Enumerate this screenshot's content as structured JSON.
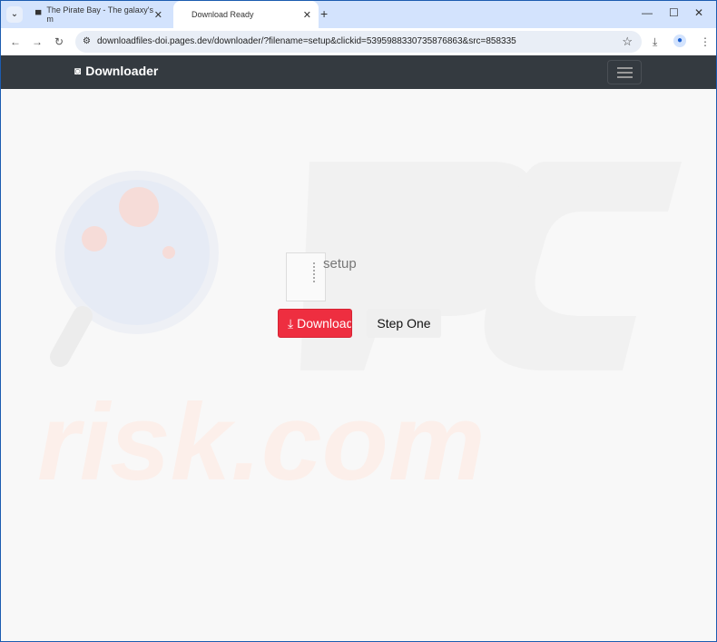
{
  "browser": {
    "tabs": [
      {
        "label": "The Pirate Bay - The galaxy's m",
        "icon": "pirate-ship-icon"
      },
      {
        "label": "Download Ready",
        "active": true
      }
    ],
    "url": "downloadfiles-doi.pages.dev/downloader/?filename=setup&clickid=5395988330735876863&src=858335"
  },
  "navbar": {
    "brand": "Downloader",
    "brand_icon": "camera-icon"
  },
  "file": {
    "name": "setup",
    "icon": "zip-file-icon"
  },
  "buttons": {
    "download": "Download",
    "step_one": "Step One"
  },
  "colors": {
    "download": "#ee2e40",
    "navbar": "#343a40"
  },
  "watermark": "PC risk.com"
}
